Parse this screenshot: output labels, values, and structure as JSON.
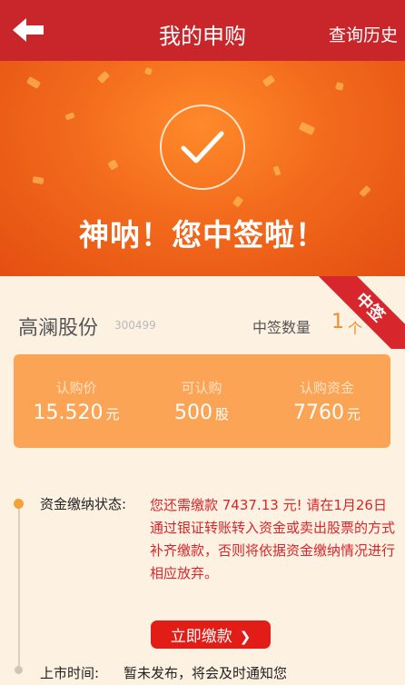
{
  "header": {
    "title": "我的申购",
    "history_link": "查询历史"
  },
  "banner": {
    "title": "神呐！您中签啦！"
  },
  "ribbon": "中签",
  "stock": {
    "name": "高澜股份",
    "code": "300499",
    "win_label": "中签数量",
    "win_count": "1",
    "win_unit": "个"
  },
  "info_card": [
    {
      "label": "认购价",
      "value": "15.520",
      "unit": "元"
    },
    {
      "label": "可认购",
      "value": "500",
      "unit": "股"
    },
    {
      "label": "认购资金",
      "value": "7760",
      "unit": "元"
    }
  ],
  "payment": {
    "label": "资金缴纳状态:",
    "status": "您还需缴款 7437.13 元! 请在1月26日通过银证转账转入资金或卖出股票的方式补齐缴款，否则将依据资金缴纳情况进行相应放弃。",
    "button": "立即缴款",
    "button_icon": "chevron-right-icon"
  },
  "listing": {
    "label": "上市时间:",
    "value": "暂未发布，将会及时通知您"
  },
  "colors": {
    "header": "#c9262c",
    "banner": "#f26a1c",
    "card": "#fca456",
    "accent": "#f08c2a",
    "alert": "#d7262c"
  }
}
